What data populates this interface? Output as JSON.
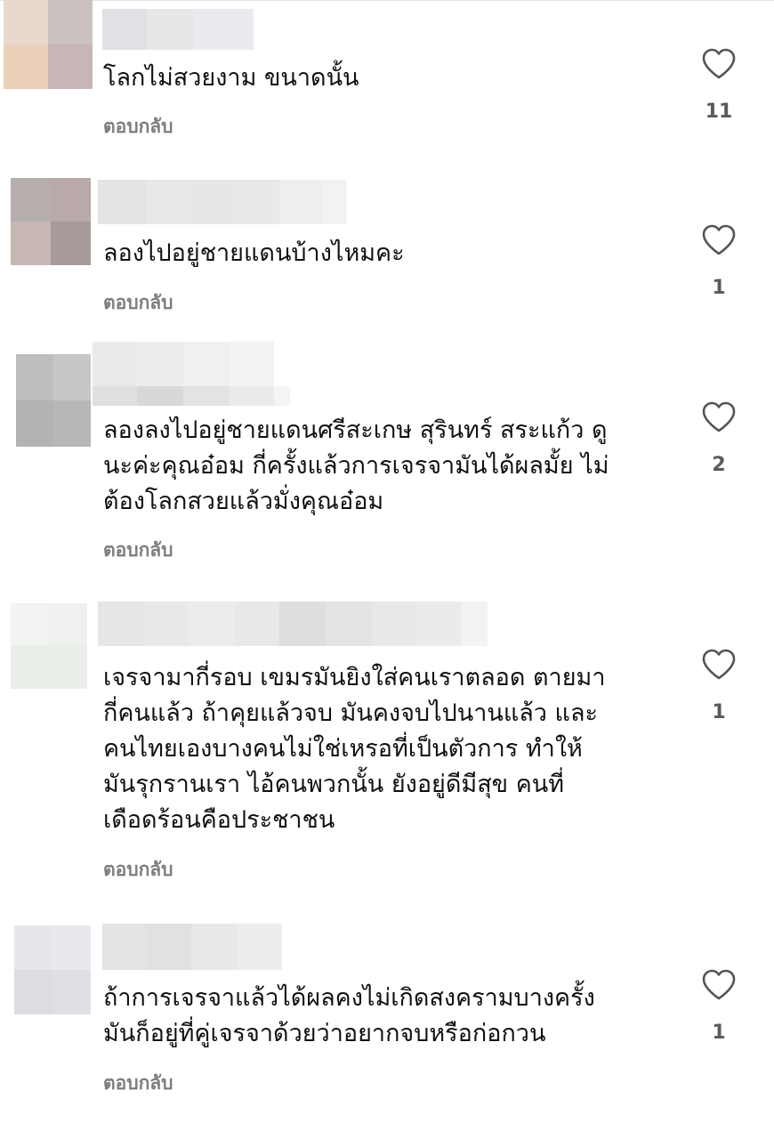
{
  "comments": [
    {
      "text": "โลกไม่สวยงาม ขนาดนั้น",
      "reply_label": "ตอบกลับ",
      "likes": "11",
      "like_icon": "heart-outline-icon"
    },
    {
      "text": "ลองไปอยู่ชายแดนบ้างไหมคะ",
      "reply_label": "ตอบกลับ",
      "likes": "1",
      "like_icon": "heart-outline-icon"
    },
    {
      "text": "ลองลงไปอยู่ชายแดนศรีสะเกษ สุรินทร์ สระแก้ว ดู\nนะค่ะคุณอ๋อม กี่ครั้งแล้วการเจรจามันได้ผลมั้ย ไม่\nต้องโลกสวยแล้วมั่งคุณอ๋อม",
      "reply_label": "ตอบกลับ",
      "likes": "2",
      "like_icon": "heart-outline-icon"
    },
    {
      "text": "เจรจามากี่รอบ เขมรมันยิงใส่คนเราตลอด ตายมา\nกี่คนแล้ว  ถ้าคุยแล้วจบ มันคงจบไปนานแล้ว  และ\nคนไทยเองบางคนไม่ใช่เหรอที่เป็นตัวการ ทำให้\nมันรุกรานเรา ไอ้คนพวกนั้น ยังอยู่ดีมีสุข  คนที่\nเดือดร้อนคือประชาชน",
      "reply_label": "ตอบกลับ",
      "likes": "1",
      "like_icon": "heart-outline-icon"
    },
    {
      "text": "ถ้าการเจรจาแล้วได้ผลคงไม่เกิดสงครามบางครั้ง\nมันก็อยู่ที่คู่เจรจาด้วยว่าอยากจบหรือก่อกวน",
      "reply_label": "ตอบกลับ",
      "likes": "1",
      "like_icon": "heart-outline-icon"
    }
  ]
}
